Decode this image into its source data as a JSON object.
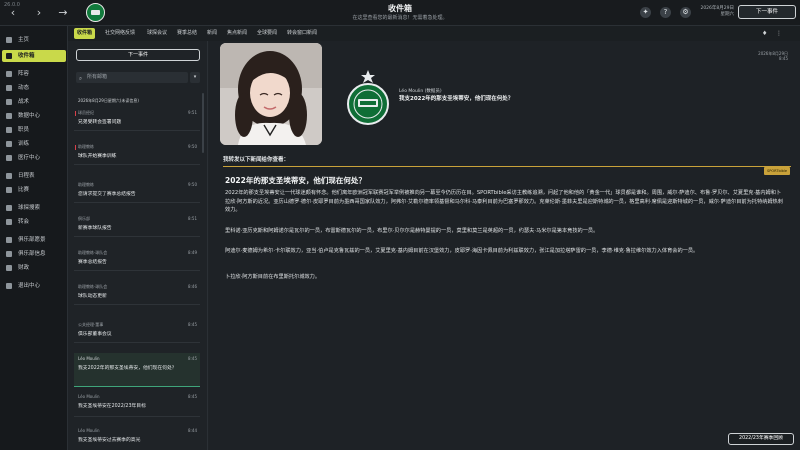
{
  "app": {
    "version": "26.0.0"
  },
  "topbar": {
    "title": "收件箱",
    "subtitle": "在这里查看您的最新消息！无需着急处理。",
    "date_line1": "2026年8月29日",
    "date_line2": "星期六",
    "continue_label": "下一事件"
  },
  "sidebar": {
    "items": [
      {
        "label": "主页"
      },
      {
        "label": "收件箱"
      },
      {
        "label": "阵容"
      },
      {
        "label": "动态"
      },
      {
        "label": "战术"
      },
      {
        "label": "数据中心"
      },
      {
        "label": "职员"
      },
      {
        "label": "训练"
      },
      {
        "label": "医疗中心"
      },
      {
        "label": "日程表"
      },
      {
        "label": "比赛"
      },
      {
        "label": "球探搜索"
      },
      {
        "label": "转会"
      },
      {
        "label": "俱乐部愿景"
      },
      {
        "label": "俱乐部信息"
      },
      {
        "label": "财政"
      },
      {
        "label": "退出中心"
      }
    ]
  },
  "tabs": [
    {
      "label": "收件箱"
    },
    {
      "label": "社交网络反馈"
    },
    {
      "label": "球探会议"
    },
    {
      "label": "赛季总结"
    },
    {
      "label": "新闻"
    },
    {
      "label": "焦点新闻"
    },
    {
      "label": "全球要闻"
    },
    {
      "label": "转会窗口新闻"
    }
  ],
  "list": {
    "continue_label": "下一事件",
    "search_placeholder": "所有邮箱",
    "messages": [
      {
        "sender": "2026年8月29日星期六(未读信息)",
        "subject": "",
        "time": ""
      },
      {
        "sender": "球员经纪",
        "subject": "兄弟受转会签署问题",
        "time": "9:51"
      },
      {
        "sender": "助理教练",
        "subject": "球队开始赛季训练",
        "time": "9:50"
      },
      {
        "sender": "助理教练",
        "subject": "您请求提交了赛季总结报告",
        "time": "9:50"
      },
      {
        "sender": "俱乐部",
        "subject": "新赛季球队报告",
        "time": "8:51"
      },
      {
        "sender": "助理教练·球队会",
        "subject": "赛季总结报告",
        "time": "8:49"
      },
      {
        "sender": "助理教练·球队会",
        "subject": "球队动态更新",
        "time": "8:46"
      },
      {
        "sender": "公关经理·董事",
        "subject": "俱乐部董事会议",
        "time": "8:45"
      },
      {
        "sender": "Léo Moulin",
        "subject": "我支2022年的那支圣埃蒂安，他们现在何处？",
        "time": "8:45"
      },
      {
        "sender": "Léo Moulin",
        "subject": "我支圣埃蒂安在2022/23年目标",
        "time": "8:45"
      },
      {
        "sender": "Léo Moulin",
        "subject": "我支圣埃蒂安过去赛季的高光",
        "time": "8:44"
      }
    ]
  },
  "content": {
    "sender_name": "Léo Moulin (数据员)",
    "subject": "我支2022年的那支圣埃蒂安，他们现在何处？",
    "date": "2026年8月29日",
    "time": "8:45",
    "intro": "我转发以下新闻给你查看：",
    "source_badge": "SPORTbible",
    "article_title": "2022年的那支圣埃蒂安，他们现在何处？",
    "paragraphs": [
      "2022年的那支圣埃蒂安让一代球迷颇有怀念。他们离年欧洲冠军联赛冠军举例被推向另一幕至今仍历历在目。SPORTbible采访主教练追溯，问起了他和他的「黄金一代」球员都是谁和。周围，威尔·萨迪尔、布鲁·罗贝尔、艾夏里克·基内姆和卜拉欣·阿方斯的近况。亚历山德罗·德尔·皮耶罗目前为墨西哥国家队效力，阿弗尔·艾勒尔德率领基督和马尔科·马泰利目前为巴塞罗那效力。克莱伦斯·墨菲夫里是迎斯特城的一员，格里高利·席佩是迎斯特城的一员，威尔·萨迪尔目前为托特纳姆热刺效力。",
      "里科诺·亚历克斯和阿姆诺尔是瓦尔的一员，布雷斯德瓦尔的一员，布里尔·贝尔尔是赫特曼提的一员，莫里和莫兰是英超的一员，约瑟夫·马米尔是第本竞技的一员。",
      "阿迪尔·麦德姆为希尔·卡尔联效力，亚当·伯卢是克鲁瓦兹的一员，艾夏里克·基内姆目前在汉堡效力，皮耶罗·海因卡佩目前为利兹联效力，张江是加拉塔萨雷的一员，李德·维克·鲁拉维尔效力入体育会的一员。",
      "卜拉欣·阿方斯目前在布里斯托尔城效力。"
    ],
    "continue_label": "2022/23年赛季回顾"
  }
}
